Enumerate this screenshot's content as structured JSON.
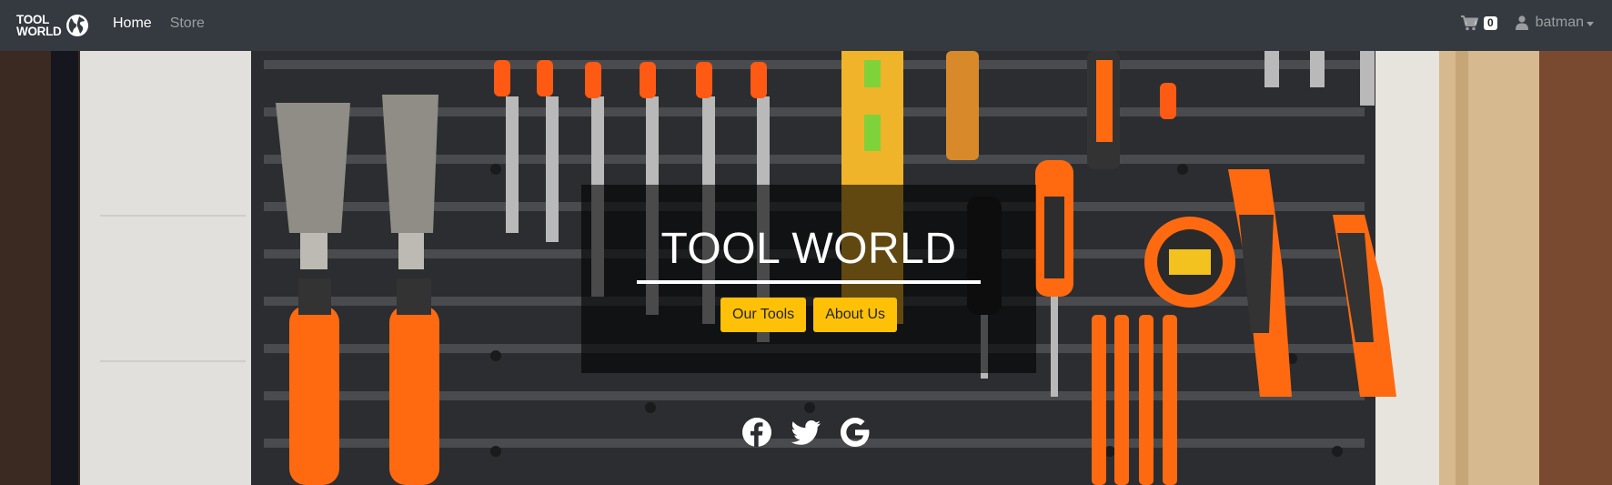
{
  "navbar": {
    "brand": {
      "line1": "TOOL",
      "line2": "WORLD"
    },
    "links": [
      {
        "label": "Home",
        "active": true
      },
      {
        "label": "Store",
        "active": false
      }
    ],
    "cart": {
      "icon": "cart-icon",
      "count": "0"
    },
    "user": {
      "icon": "user-icon",
      "name": "batman"
    }
  },
  "hero": {
    "title": "TOOL WORLD",
    "buttons": [
      "Our Tools",
      "About Us"
    ],
    "social": [
      "facebook-icon",
      "twitter-icon",
      "google-icon"
    ]
  },
  "colors": {
    "navbar_bg": "#343a40",
    "accent": "#ffc107",
    "panel": "rgba(0,0,0,0.6)"
  }
}
